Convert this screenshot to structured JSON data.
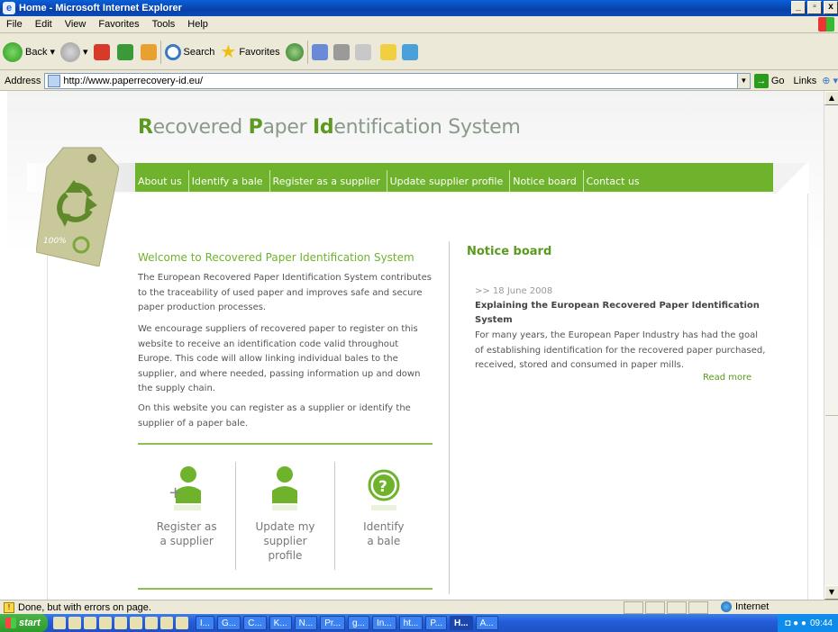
{
  "window": {
    "title": "Home - Microsoft Internet Explorer"
  },
  "menu": [
    "File",
    "Edit",
    "View",
    "Favorites",
    "Tools",
    "Help"
  ],
  "toolbar": {
    "back": "Back",
    "search": "Search",
    "favorites": "Favorites"
  },
  "address": {
    "label": "Address",
    "url": "http://www.paperrecovery-id.eu/",
    "go": "Go",
    "links": "Links"
  },
  "site": {
    "title_parts": [
      "R",
      "ecovered ",
      "P",
      "aper ",
      "Id",
      "entification System"
    ],
    "nav": [
      "About us",
      "Identify a bale",
      "Register as a supplier",
      "Update supplier profile",
      "Notice board",
      "Contact us"
    ],
    "tag_label": "100%"
  },
  "welcome": {
    "title": "Welcome to Recovered Paper Identification System",
    "p1": "The European Recovered Paper Identification System contributes to the traceability of used paper and improves safe and secure paper production processes.",
    "p2": "We encourage suppliers of recovered paper to register on this website to receive an identification code valid throughout Europe. This code will allow linking individual bales to the supplier, and where needed, passing information up and down the supply chain.",
    "p3": "On this website you can register as a supplier or identify the supplier of a paper bale."
  },
  "actions": [
    {
      "label1": "Register as",
      "label2": "a supplier",
      "label3": ""
    },
    {
      "label1": "Update my",
      "label2": "supplier",
      "label3": "profile"
    },
    {
      "label1": "Identify",
      "label2": "a bale",
      "label3": ""
    }
  ],
  "notice": {
    "title": "Notice board",
    "date": ">> 18 June 2008",
    "headline": "Explaining the European Recovered Paper Identification System",
    "text": "For many years, the European Paper Industry has had the goal of establishing identification for the recovered paper purchased, received, stored and consumed in paper mills.",
    "more": "Read more"
  },
  "status": {
    "text": "Done, but with errors on page.",
    "zone": "Internet"
  },
  "taskbar": {
    "start": "start",
    "tasks": [
      "I...",
      "G...",
      "C...",
      "K...",
      "N...",
      "Pr...",
      "g...",
      "In...",
      "ht...",
      "P...",
      "H...",
      "A..."
    ],
    "clock": "09:44"
  },
  "colors": {
    "brand_green": "#6fb32c",
    "title_grey": "#8a9a8a"
  }
}
